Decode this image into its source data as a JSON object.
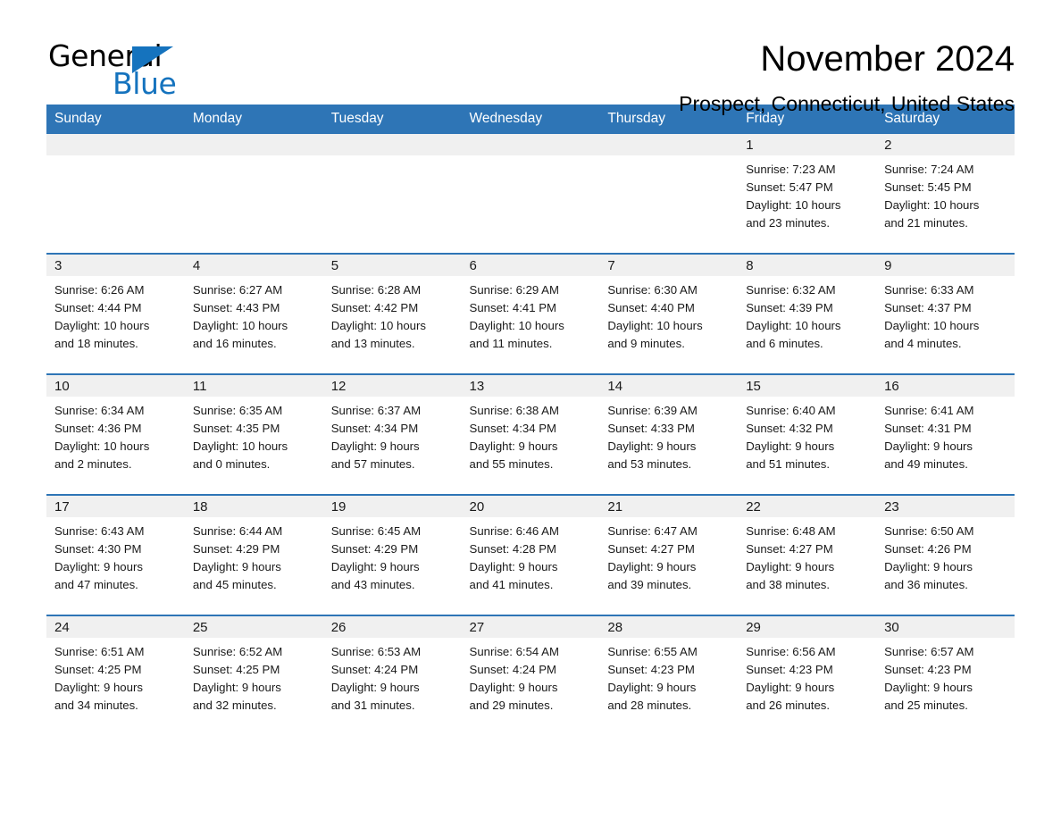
{
  "logo": {
    "word_one": "General",
    "word_two": "Blue",
    "triangle_icon": "blue-triangle-icon",
    "brand_color": "#1573be"
  },
  "header": {
    "month_title": "November 2024",
    "location": "Prospect, Connecticut, United States"
  },
  "colors": {
    "header_blue": "#2e75b6",
    "daynum_band": "#f0f0f0",
    "row_separator": "#2e75b6",
    "text": "#1a1a1a",
    "background": "#ffffff"
  },
  "calendar": {
    "weekday_headers": [
      "Sunday",
      "Monday",
      "Tuesday",
      "Wednesday",
      "Thursday",
      "Friday",
      "Saturday"
    ],
    "labels": {
      "sunrise": "Sunrise:",
      "sunset": "Sunset:",
      "daylight": "Daylight:"
    },
    "weeks": [
      [
        {
          "day": "",
          "lines": []
        },
        {
          "day": "",
          "lines": []
        },
        {
          "day": "",
          "lines": []
        },
        {
          "day": "",
          "lines": []
        },
        {
          "day": "",
          "lines": []
        },
        {
          "day": "1",
          "lines": [
            "Sunrise: 7:23 AM",
            "Sunset: 5:47 PM",
            "Daylight: 10 hours",
            "and 23 minutes."
          ]
        },
        {
          "day": "2",
          "lines": [
            "Sunrise: 7:24 AM",
            "Sunset: 5:45 PM",
            "Daylight: 10 hours",
            "and 21 minutes."
          ]
        }
      ],
      [
        {
          "day": "3",
          "lines": [
            "Sunrise: 6:26 AM",
            "Sunset: 4:44 PM",
            "Daylight: 10 hours",
            "and 18 minutes."
          ]
        },
        {
          "day": "4",
          "lines": [
            "Sunrise: 6:27 AM",
            "Sunset: 4:43 PM",
            "Daylight: 10 hours",
            "and 16 minutes."
          ]
        },
        {
          "day": "5",
          "lines": [
            "Sunrise: 6:28 AM",
            "Sunset: 4:42 PM",
            "Daylight: 10 hours",
            "and 13 minutes."
          ]
        },
        {
          "day": "6",
          "lines": [
            "Sunrise: 6:29 AM",
            "Sunset: 4:41 PM",
            "Daylight: 10 hours",
            "and 11 minutes."
          ]
        },
        {
          "day": "7",
          "lines": [
            "Sunrise: 6:30 AM",
            "Sunset: 4:40 PM",
            "Daylight: 10 hours",
            "and 9 minutes."
          ]
        },
        {
          "day": "8",
          "lines": [
            "Sunrise: 6:32 AM",
            "Sunset: 4:39 PM",
            "Daylight: 10 hours",
            "and 6 minutes."
          ]
        },
        {
          "day": "9",
          "lines": [
            "Sunrise: 6:33 AM",
            "Sunset: 4:37 PM",
            "Daylight: 10 hours",
            "and 4 minutes."
          ]
        }
      ],
      [
        {
          "day": "10",
          "lines": [
            "Sunrise: 6:34 AM",
            "Sunset: 4:36 PM",
            "Daylight: 10 hours",
            "and 2 minutes."
          ]
        },
        {
          "day": "11",
          "lines": [
            "Sunrise: 6:35 AM",
            "Sunset: 4:35 PM",
            "Daylight: 10 hours",
            "and 0 minutes."
          ]
        },
        {
          "day": "12",
          "lines": [
            "Sunrise: 6:37 AM",
            "Sunset: 4:34 PM",
            "Daylight: 9 hours",
            "and 57 minutes."
          ]
        },
        {
          "day": "13",
          "lines": [
            "Sunrise: 6:38 AM",
            "Sunset: 4:34 PM",
            "Daylight: 9 hours",
            "and 55 minutes."
          ]
        },
        {
          "day": "14",
          "lines": [
            "Sunrise: 6:39 AM",
            "Sunset: 4:33 PM",
            "Daylight: 9 hours",
            "and 53 minutes."
          ]
        },
        {
          "day": "15",
          "lines": [
            "Sunrise: 6:40 AM",
            "Sunset: 4:32 PM",
            "Daylight: 9 hours",
            "and 51 minutes."
          ]
        },
        {
          "day": "16",
          "lines": [
            "Sunrise: 6:41 AM",
            "Sunset: 4:31 PM",
            "Daylight: 9 hours",
            "and 49 minutes."
          ]
        }
      ],
      [
        {
          "day": "17",
          "lines": [
            "Sunrise: 6:43 AM",
            "Sunset: 4:30 PM",
            "Daylight: 9 hours",
            "and 47 minutes."
          ]
        },
        {
          "day": "18",
          "lines": [
            "Sunrise: 6:44 AM",
            "Sunset: 4:29 PM",
            "Daylight: 9 hours",
            "and 45 minutes."
          ]
        },
        {
          "day": "19",
          "lines": [
            "Sunrise: 6:45 AM",
            "Sunset: 4:29 PM",
            "Daylight: 9 hours",
            "and 43 minutes."
          ]
        },
        {
          "day": "20",
          "lines": [
            "Sunrise: 6:46 AM",
            "Sunset: 4:28 PM",
            "Daylight: 9 hours",
            "and 41 minutes."
          ]
        },
        {
          "day": "21",
          "lines": [
            "Sunrise: 6:47 AM",
            "Sunset: 4:27 PM",
            "Daylight: 9 hours",
            "and 39 minutes."
          ]
        },
        {
          "day": "22",
          "lines": [
            "Sunrise: 6:48 AM",
            "Sunset: 4:27 PM",
            "Daylight: 9 hours",
            "and 38 minutes."
          ]
        },
        {
          "day": "23",
          "lines": [
            "Sunrise: 6:50 AM",
            "Sunset: 4:26 PM",
            "Daylight: 9 hours",
            "and 36 minutes."
          ]
        }
      ],
      [
        {
          "day": "24",
          "lines": [
            "Sunrise: 6:51 AM",
            "Sunset: 4:25 PM",
            "Daylight: 9 hours",
            "and 34 minutes."
          ]
        },
        {
          "day": "25",
          "lines": [
            "Sunrise: 6:52 AM",
            "Sunset: 4:25 PM",
            "Daylight: 9 hours",
            "and 32 minutes."
          ]
        },
        {
          "day": "26",
          "lines": [
            "Sunrise: 6:53 AM",
            "Sunset: 4:24 PM",
            "Daylight: 9 hours",
            "and 31 minutes."
          ]
        },
        {
          "day": "27",
          "lines": [
            "Sunrise: 6:54 AM",
            "Sunset: 4:24 PM",
            "Daylight: 9 hours",
            "and 29 minutes."
          ]
        },
        {
          "day": "28",
          "lines": [
            "Sunrise: 6:55 AM",
            "Sunset: 4:23 PM",
            "Daylight: 9 hours",
            "and 28 minutes."
          ]
        },
        {
          "day": "29",
          "lines": [
            "Sunrise: 6:56 AM",
            "Sunset: 4:23 PM",
            "Daylight: 9 hours",
            "and 26 minutes."
          ]
        },
        {
          "day": "30",
          "lines": [
            "Sunrise: 6:57 AM",
            "Sunset: 4:23 PM",
            "Daylight: 9 hours",
            "and 25 minutes."
          ]
        }
      ]
    ]
  }
}
